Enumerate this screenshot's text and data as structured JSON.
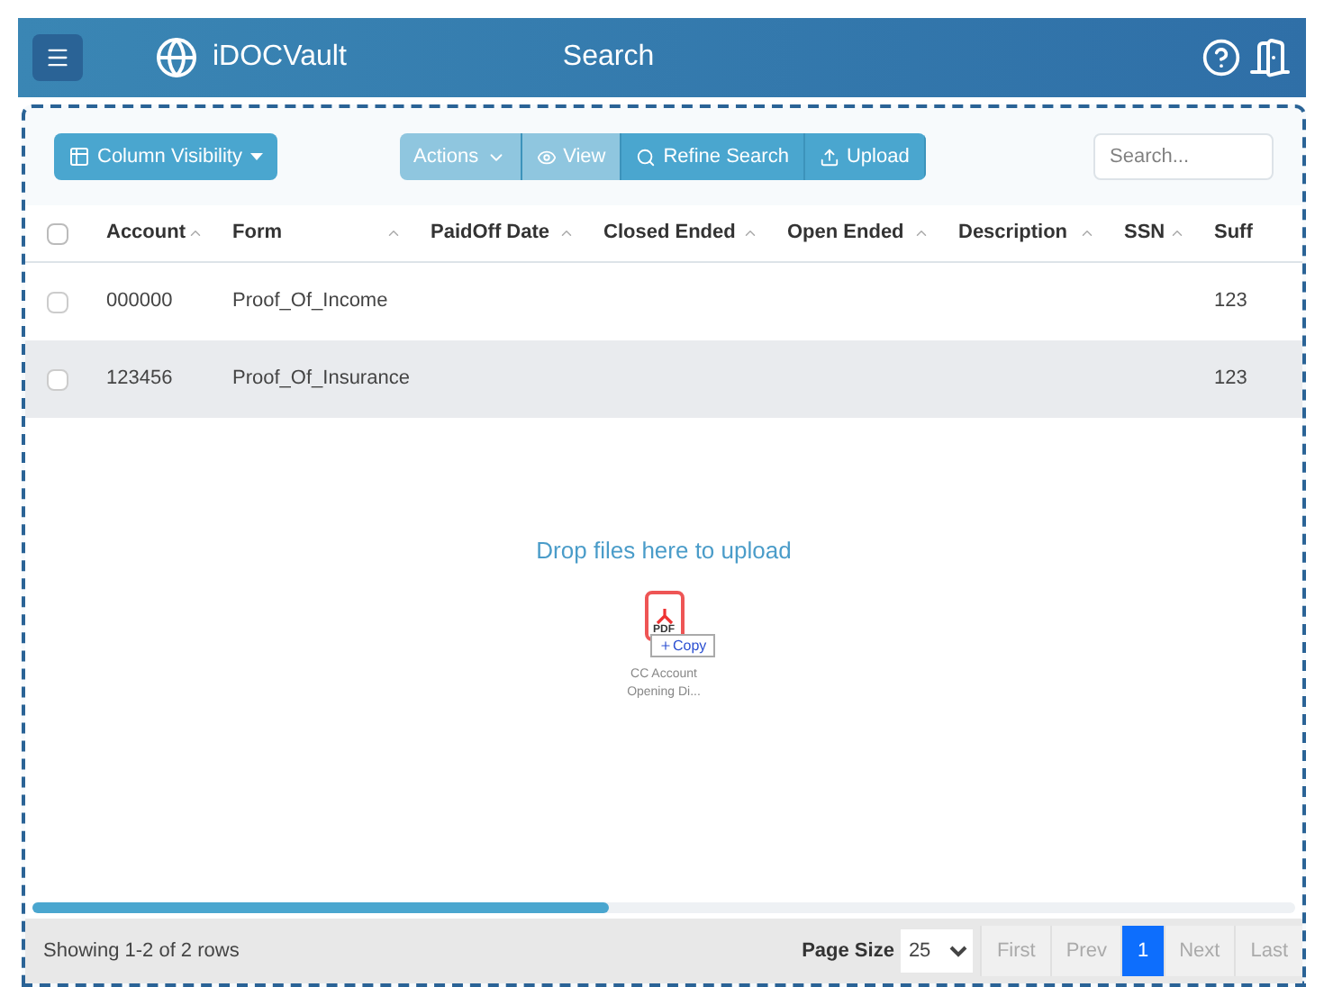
{
  "header": {
    "brand": "iDOCVault",
    "title": "Search"
  },
  "toolbar": {
    "column_visibility": "Column Visibility",
    "actions": [
      {
        "label": "Actions",
        "kind": "dropdown",
        "disabled": true
      },
      {
        "label": "View",
        "kind": "view",
        "disabled": true
      },
      {
        "label": "Refine Search",
        "kind": "search",
        "disabled": false
      },
      {
        "label": "Upload",
        "kind": "upload",
        "disabled": false
      }
    ],
    "search": {
      "placeholder": "Search..."
    }
  },
  "table": {
    "all_checked": false,
    "columns": [
      "Account",
      "Form",
      "PaidOff Date",
      "Closed Ended",
      "Open Ended",
      "Description",
      "SSN",
      "Suff"
    ],
    "rows": [
      {
        "checked": false,
        "selected": false,
        "cells": [
          "000000",
          "Proof_Of_Income",
          "",
          "",
          "",
          "",
          "",
          "123"
        ]
      },
      {
        "checked": false,
        "selected": true,
        "cells": [
          "123456",
          "Proof_Of_Insurance",
          "",
          "",
          "",
          "",
          "",
          "123"
        ]
      }
    ]
  },
  "dropzone": {
    "message": "Drop files here to upload",
    "file_label": "PDF",
    "copy": "Copy",
    "file_name": "CC Account Opening Di..."
  },
  "footer": {
    "status": "Showing 1-2 of 2 rows",
    "page_size_label": "Page Size",
    "page_size": "25",
    "pages": [
      {
        "label": "First",
        "selected": false,
        "disabled": true
      },
      {
        "label": "Prev",
        "selected": false,
        "disabled": true
      },
      {
        "label": "1",
        "selected": true,
        "disabled": false
      },
      {
        "label": "Next",
        "selected": false,
        "disabled": true
      },
      {
        "label": "Last",
        "selected": false,
        "disabled": true
      }
    ]
  }
}
